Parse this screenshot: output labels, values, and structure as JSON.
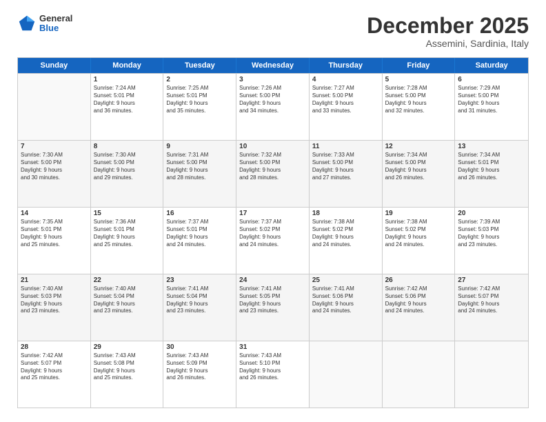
{
  "header": {
    "logo": {
      "general": "General",
      "blue": "Blue"
    },
    "title": "December 2025",
    "location": "Assemini, Sardinia, Italy"
  },
  "calendar": {
    "days_of_week": [
      "Sunday",
      "Monday",
      "Tuesday",
      "Wednesday",
      "Thursday",
      "Friday",
      "Saturday"
    ],
    "rows": [
      [
        {
          "day": "",
          "info": ""
        },
        {
          "day": "1",
          "info": "Sunrise: 7:24 AM\nSunset: 5:01 PM\nDaylight: 9 hours\nand 36 minutes."
        },
        {
          "day": "2",
          "info": "Sunrise: 7:25 AM\nSunset: 5:01 PM\nDaylight: 9 hours\nand 35 minutes."
        },
        {
          "day": "3",
          "info": "Sunrise: 7:26 AM\nSunset: 5:00 PM\nDaylight: 9 hours\nand 34 minutes."
        },
        {
          "day": "4",
          "info": "Sunrise: 7:27 AM\nSunset: 5:00 PM\nDaylight: 9 hours\nand 33 minutes."
        },
        {
          "day": "5",
          "info": "Sunrise: 7:28 AM\nSunset: 5:00 PM\nDaylight: 9 hours\nand 32 minutes."
        },
        {
          "day": "6",
          "info": "Sunrise: 7:29 AM\nSunset: 5:00 PM\nDaylight: 9 hours\nand 31 minutes."
        }
      ],
      [
        {
          "day": "7",
          "info": "Sunrise: 7:30 AM\nSunset: 5:00 PM\nDaylight: 9 hours\nand 30 minutes."
        },
        {
          "day": "8",
          "info": "Sunrise: 7:30 AM\nSunset: 5:00 PM\nDaylight: 9 hours\nand 29 minutes."
        },
        {
          "day": "9",
          "info": "Sunrise: 7:31 AM\nSunset: 5:00 PM\nDaylight: 9 hours\nand 28 minutes."
        },
        {
          "day": "10",
          "info": "Sunrise: 7:32 AM\nSunset: 5:00 PM\nDaylight: 9 hours\nand 28 minutes."
        },
        {
          "day": "11",
          "info": "Sunrise: 7:33 AM\nSunset: 5:00 PM\nDaylight: 9 hours\nand 27 minutes."
        },
        {
          "day": "12",
          "info": "Sunrise: 7:34 AM\nSunset: 5:00 PM\nDaylight: 9 hours\nand 26 minutes."
        },
        {
          "day": "13",
          "info": "Sunrise: 7:34 AM\nSunset: 5:01 PM\nDaylight: 9 hours\nand 26 minutes."
        }
      ],
      [
        {
          "day": "14",
          "info": "Sunrise: 7:35 AM\nSunset: 5:01 PM\nDaylight: 9 hours\nand 25 minutes."
        },
        {
          "day": "15",
          "info": "Sunrise: 7:36 AM\nSunset: 5:01 PM\nDaylight: 9 hours\nand 25 minutes."
        },
        {
          "day": "16",
          "info": "Sunrise: 7:37 AM\nSunset: 5:01 PM\nDaylight: 9 hours\nand 24 minutes."
        },
        {
          "day": "17",
          "info": "Sunrise: 7:37 AM\nSunset: 5:02 PM\nDaylight: 9 hours\nand 24 minutes."
        },
        {
          "day": "18",
          "info": "Sunrise: 7:38 AM\nSunset: 5:02 PM\nDaylight: 9 hours\nand 24 minutes."
        },
        {
          "day": "19",
          "info": "Sunrise: 7:38 AM\nSunset: 5:02 PM\nDaylight: 9 hours\nand 24 minutes."
        },
        {
          "day": "20",
          "info": "Sunrise: 7:39 AM\nSunset: 5:03 PM\nDaylight: 9 hours\nand 23 minutes."
        }
      ],
      [
        {
          "day": "21",
          "info": "Sunrise: 7:40 AM\nSunset: 5:03 PM\nDaylight: 9 hours\nand 23 minutes."
        },
        {
          "day": "22",
          "info": "Sunrise: 7:40 AM\nSunset: 5:04 PM\nDaylight: 9 hours\nand 23 minutes."
        },
        {
          "day": "23",
          "info": "Sunrise: 7:41 AM\nSunset: 5:04 PM\nDaylight: 9 hours\nand 23 minutes."
        },
        {
          "day": "24",
          "info": "Sunrise: 7:41 AM\nSunset: 5:05 PM\nDaylight: 9 hours\nand 23 minutes."
        },
        {
          "day": "25",
          "info": "Sunrise: 7:41 AM\nSunset: 5:06 PM\nDaylight: 9 hours\nand 24 minutes."
        },
        {
          "day": "26",
          "info": "Sunrise: 7:42 AM\nSunset: 5:06 PM\nDaylight: 9 hours\nand 24 minutes."
        },
        {
          "day": "27",
          "info": "Sunrise: 7:42 AM\nSunset: 5:07 PM\nDaylight: 9 hours\nand 24 minutes."
        }
      ],
      [
        {
          "day": "28",
          "info": "Sunrise: 7:42 AM\nSunset: 5:07 PM\nDaylight: 9 hours\nand 25 minutes."
        },
        {
          "day": "29",
          "info": "Sunrise: 7:43 AM\nSunset: 5:08 PM\nDaylight: 9 hours\nand 25 minutes."
        },
        {
          "day": "30",
          "info": "Sunrise: 7:43 AM\nSunset: 5:09 PM\nDaylight: 9 hours\nand 26 minutes."
        },
        {
          "day": "31",
          "info": "Sunrise: 7:43 AM\nSunset: 5:10 PM\nDaylight: 9 hours\nand 26 minutes."
        },
        {
          "day": "",
          "info": ""
        },
        {
          "day": "",
          "info": ""
        },
        {
          "day": "",
          "info": ""
        }
      ]
    ]
  }
}
